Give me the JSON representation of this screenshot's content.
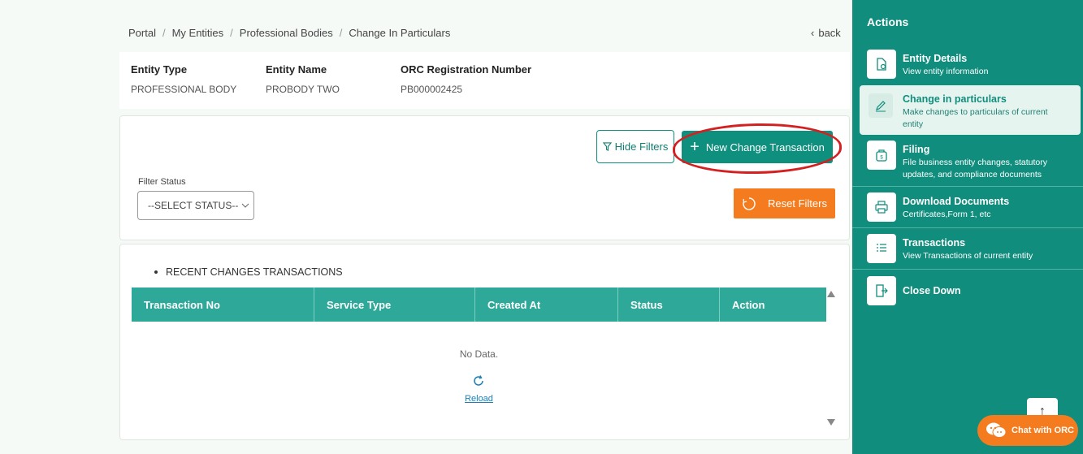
{
  "breadcrumb": [
    "Portal",
    "My Entities",
    "Professional Bodies",
    "Change In Particulars"
  ],
  "back_label": "back",
  "entity": {
    "type_label": "Entity Type",
    "type_value": "PROFESSIONAL BODY",
    "name_label": "Entity Name",
    "name_value": "PROBODY TWO",
    "reg_label": "ORC Registration Number",
    "reg_value": "PB000002425"
  },
  "filters": {
    "hide_label": "Hide Filters",
    "new_tx_label": "New Change Transaction",
    "status_label": "Filter Status",
    "status_value": "--SELECT STATUS--",
    "reset_label": "Reset Filters"
  },
  "transactions": {
    "heading": "RECENT CHANGES TRANSACTIONS",
    "columns": [
      "Transaction No",
      "Service Type",
      "Created At",
      "Status",
      "Action"
    ],
    "empty_text": "No Data.",
    "reload_label": "Reload"
  },
  "sidebar": {
    "title": "Actions",
    "items": [
      {
        "title": "Entity Details",
        "desc": "View entity information",
        "icon": "document-icon"
      },
      {
        "title": "Change in particulars",
        "desc": "Make changes to particulars of current entity",
        "icon": "pen-icon"
      },
      {
        "title": "Filing",
        "desc": "File business entity changes, statutory updates, and compliance documents",
        "icon": "bag-icon"
      },
      {
        "title": "Download Documents",
        "desc": "Certificates,Form 1, etc",
        "icon": "printer-icon"
      },
      {
        "title": "Transactions",
        "desc": "View Transactions of current entity",
        "icon": "list-icon"
      },
      {
        "title": "Close Down",
        "desc": "",
        "icon": "exit-icon"
      }
    ]
  },
  "chat_label": "Chat with ORC",
  "colors": {
    "primary": "#118d7d",
    "accent": "#f47c1e",
    "table_header": "#2ea899",
    "annotation": "#d42020"
  }
}
